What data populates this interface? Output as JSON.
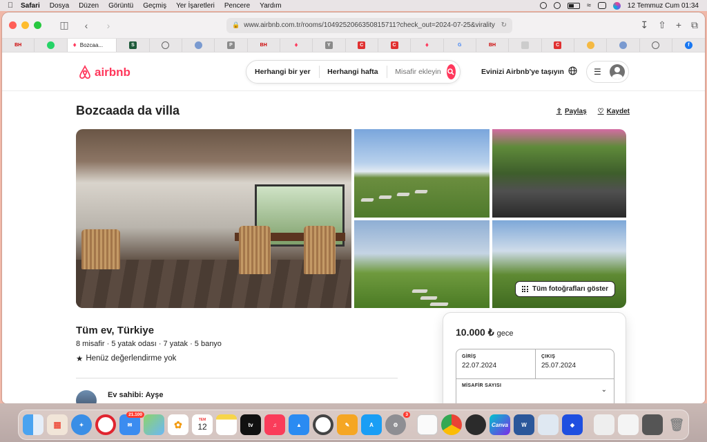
{
  "menubar": {
    "app": "Safari",
    "items": [
      "Dosya",
      "Düzen",
      "Görüntü",
      "Geçmiş",
      "Yer İşaretleri",
      "Pencere",
      "Yardım"
    ],
    "datetime": "12 Temmuz Cum  01:34"
  },
  "browser": {
    "url": "www.airbnb.com.tr/rooms/1049252066350815711?check_out=2024-07-25&virality",
    "active_tab": "Bozcaa...",
    "tab_favicons": [
      "BH",
      "whatsapp-icon",
      "airbnb-icon",
      "S",
      "globe-icon",
      "globe-icon",
      "P",
      "BH",
      "airbnb-icon",
      "Y",
      "C",
      "C",
      "airbnb-icon",
      "G",
      "BH",
      "doc-icon",
      "C",
      "coin-icon",
      "globe-icon",
      "globe-icon",
      "facebook-icon"
    ]
  },
  "header": {
    "logo": "airbnb",
    "search_where": "Herhangi bir yer",
    "search_when": "Herhangi hafta",
    "search_guests": "Misafir ekleyin",
    "host_link": "Evinizi Airbnb'ye taşıyın"
  },
  "listing": {
    "title": "Bozcaada da villa",
    "share": "Paylaş",
    "save": "Kaydet",
    "show_all_photos": "Tüm fotoğrafları göster",
    "type_location": "Tüm ev, Türkiye",
    "details": "8 misafir · 5 yatak odası · 7 yatak · 5 banyo",
    "rating": "Henüz değerlendirme yok",
    "host": "Ev sahibi: Ayşe"
  },
  "booking": {
    "price": "10.000 ₺",
    "per": "gece",
    "checkin_label": "GİRİŞ",
    "checkin_value": "22.07.2024",
    "checkout_label": "ÇIKIŞ",
    "checkout_value": "25.07.2024",
    "guests_label": "MİSAFİR SAYISI"
  },
  "dock": {
    "mail_badge": "21.100",
    "calendar_month": "TEM",
    "calendar_day": "12",
    "appstore_badge": "3"
  },
  "colors": {
    "brand": "#ff385c"
  }
}
